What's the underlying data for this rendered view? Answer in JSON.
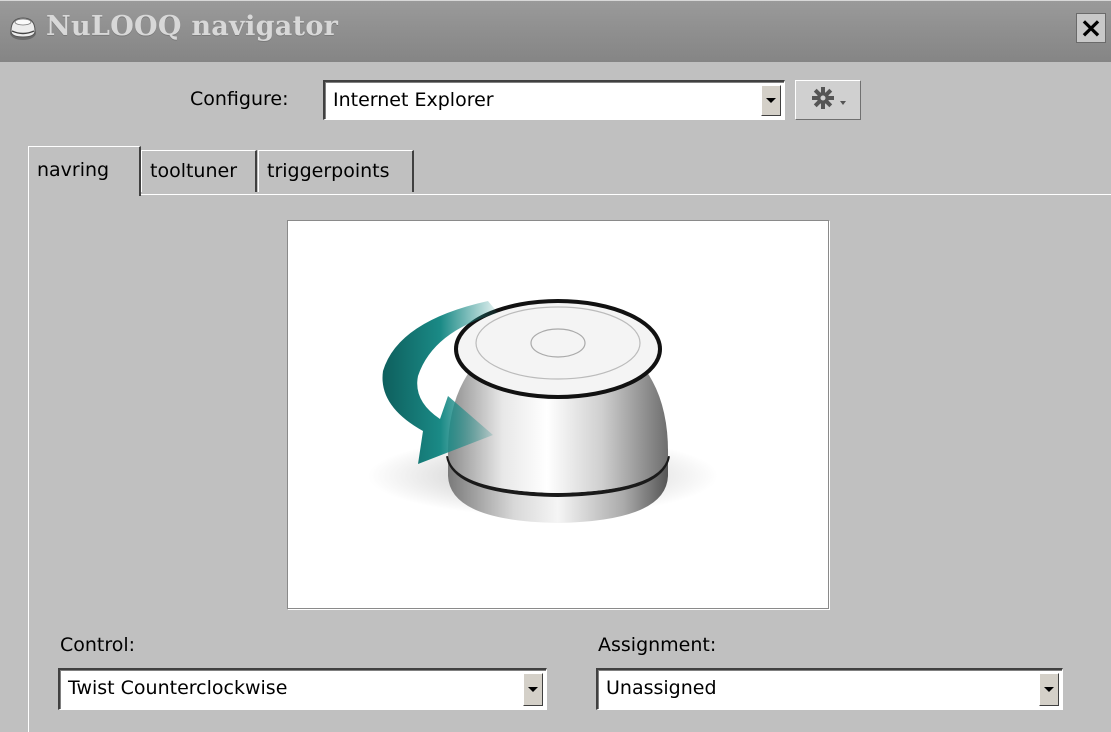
{
  "window": {
    "title": "NuLOOQ navigator",
    "close_symbol": "×",
    "close_icon": "close-icon",
    "app_icon": "nulooq-device-icon"
  },
  "configure": {
    "label": "Configure:",
    "selected": "Internet Explorer",
    "options_icon": "gear-icon"
  },
  "tabs": [
    {
      "label": "navring",
      "active": true
    },
    {
      "label": "tooltuner",
      "active": false
    },
    {
      "label": "triggerpoints",
      "active": false
    }
  ],
  "illustration": {
    "subject": "navring twist counterclockwise",
    "accent_color": "#1a8a86"
  },
  "control": {
    "label": "Control:",
    "selected": "Twist Counterclockwise"
  },
  "assignment": {
    "label": "Assignment:",
    "selected": "Unassigned"
  }
}
